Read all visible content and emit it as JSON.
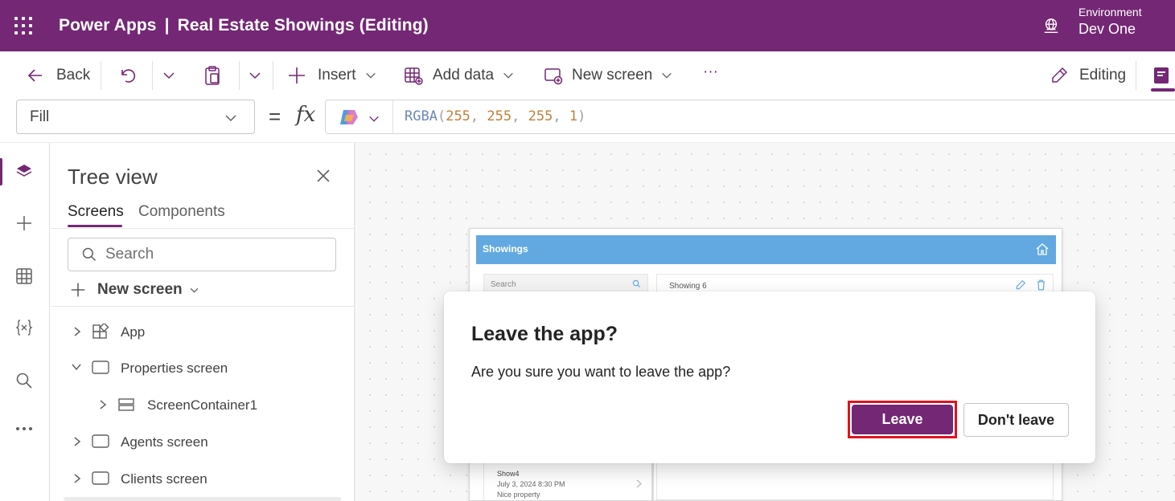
{
  "header": {
    "app_name": "Power Apps",
    "separator": "|",
    "app_title": "Real Estate Showings (Editing)",
    "environment_label": "Environment",
    "environment_name": "Dev One"
  },
  "toolbar": {
    "back_label": "Back",
    "insert_label": "Insert",
    "add_data_label": "Add data",
    "new_screen_label": "New screen",
    "more_label": "···",
    "editing_label": "Editing"
  },
  "formula_bar": {
    "property": "Fill",
    "equals": "=",
    "fx": "fx",
    "formula_fn": "RGBA",
    "formula_args": [
      "255",
      "255",
      "255",
      "1"
    ]
  },
  "tree_view": {
    "title": "Tree view",
    "tabs": [
      {
        "label": "Screens",
        "active": true
      },
      {
        "label": "Components",
        "active": false
      }
    ],
    "search_placeholder": "Search",
    "new_screen_label": "New screen",
    "items": [
      {
        "label": "App",
        "icon": "app-icon",
        "expanded": false,
        "level": 0
      },
      {
        "label": "Properties screen",
        "icon": "screen-icon",
        "expanded": true,
        "level": 0
      },
      {
        "label": "ScreenContainer1",
        "icon": "container-icon",
        "expanded": false,
        "level": 1
      },
      {
        "label": "Agents screen",
        "icon": "screen-icon",
        "expanded": false,
        "level": 0
      },
      {
        "label": "Clients screen",
        "icon": "screen-icon",
        "expanded": false,
        "level": 0
      }
    ]
  },
  "canvas_app": {
    "header_title": "Showings",
    "search_placeholder": "Search",
    "detail_title": "Showing 6",
    "list_item": {
      "title": "Show4",
      "date": "July 3, 2024 8:30 PM",
      "note": "Nice property"
    }
  },
  "dialog": {
    "title": "Leave the app?",
    "message": "Are you sure you want to leave the app?",
    "primary_label": "Leave",
    "secondary_label": "Don't leave"
  },
  "colors": {
    "brand": "#742774",
    "highlight": "#e0121e",
    "app_header": "#62a9e2"
  }
}
